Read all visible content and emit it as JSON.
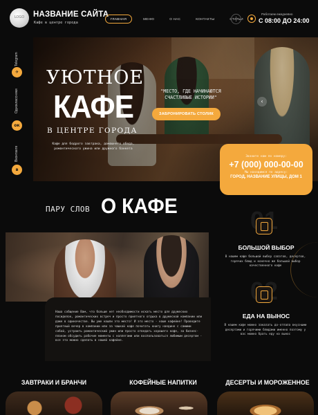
{
  "header": {
    "logo_text": "LOGO",
    "site_title": "НАЗВАНИЕ САЙТА",
    "site_subtitle": "Кафе в центре города",
    "nav": [
      {
        "label": "ГЛАВНАЯ",
        "active": true
      },
      {
        "label": "МЕНЮ",
        "active": false
      },
      {
        "label": "О НАС",
        "active": false
      },
      {
        "label": "КОНТАКТЫ",
        "active": false
      },
      {
        "label": "СТАТЬИ",
        "active": false
      }
    ],
    "menu_icon": "⋮",
    "hours_label": "Работаем ежедневно",
    "hours": "С 08:00 ДО 24:00"
  },
  "social": [
    {
      "label": "Telegram",
      "icon": "telegram-icon",
      "glyph": "✈"
    },
    {
      "label": "Одноклассники",
      "icon": "odnoklassniki-icon",
      "glyph": "ок"
    },
    {
      "label": "Вконтакте",
      "icon": "vk-icon",
      "glyph": "в"
    }
  ],
  "hero": {
    "title_line1": "УЮТНОЕ",
    "title_line2": "КАФЕ",
    "title_line3": "В ЦЕНТРЕ ГОРОДА",
    "description": "Кафе для бодрого завтрака, домашнего обеда, романтического ужина или дружного банкета",
    "quote": "\"МЕСТО, ГДЕ НАЧИНАЮТСЯ СЧАСТЛИВЫЕ ИСТОРИИ\"",
    "reserve_button": "ЗАБРОНИРОВАТЬ СТОЛИК",
    "prev_arrow": "‹",
    "next_arrow": "›"
  },
  "contact": {
    "phone_label": "Звоните нам по номеру:",
    "phone": "+7 (000) 000-00-00",
    "address_label": "Мы находимся по адресу:",
    "address": "ГОРОД, НАЗВАНИЕ УЛИЦЫ, ДОМ 1"
  },
  "about": {
    "heading_small": "ПАРУ СЛОВ",
    "heading_big": "О КАФЕ",
    "text": "Наша cобщение Вам, что больше нет необходимости искать место для дружеских посиделок, романтических встреч и просто приятного отдыха в дружеской компании или даже в одиночестве. Вы уже нашли это место! И это место - наше кафейне! Проведите приятный вечер в компании или за чашкой кофе почитать книгу наедине с самими собой, устроить романтический ужин или просто отведать хорошего кофе, за бизнес-планом обсудить рабочие моменты с коллегами или воспользоваться любимым десертом - все это можно сделать в нашей кафейне."
  },
  "features": [
    {
      "number": "01",
      "icon": "menu-book-icon",
      "title": "БОЛЬШОЙ ВЫБОР",
      "text": "В нашем кафе большой выбор салатов, десертов, горячих блюд и конечно же большой выбор качественного кофе"
    },
    {
      "number": "02",
      "icon": "takeaway-cup-icon",
      "title": "ЕДА НА ВЫНОС",
      "text": "В нашем кафе можно заказать до-отпала вкусными десертами и горячими блюдами именно поэтому у вас можно брать еду на вынос"
    }
  ],
  "categories": [
    {
      "title": "ЗАВТРАКИ И БРАНЧИ",
      "image": "breakfast-photo"
    },
    {
      "title": "КОФЕЙНЫЕ НАПИТКИ",
      "image": "coffee-photo"
    },
    {
      "title": "ДЕСЕРТЫ И МОРОЖЕННОЕ",
      "image": "desserts-photo"
    }
  ],
  "colors": {
    "accent": "#f4a93d",
    "background": "#0b0b0b",
    "text": "#ffffff"
  }
}
